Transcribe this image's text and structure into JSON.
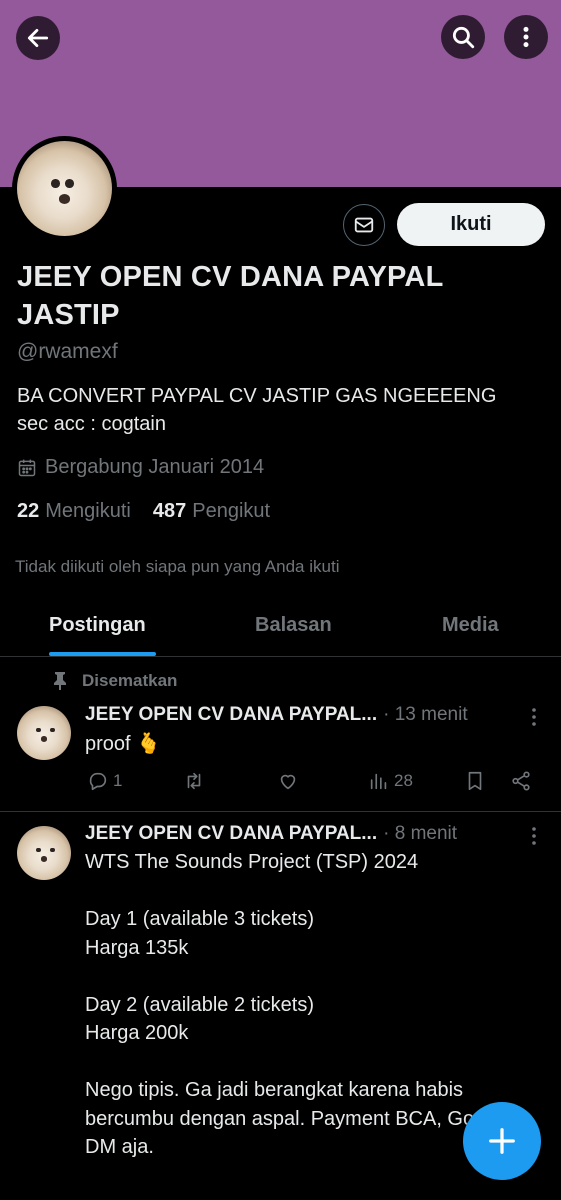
{
  "colors": {
    "banner": "#93599a",
    "accent": "#1d9bf0",
    "background": "#000000",
    "muted_text": "#71767b"
  },
  "header": {
    "back_icon": "arrow-left-icon",
    "search_icon": "search-icon",
    "more_icon": "more-vertical-icon"
  },
  "profile": {
    "name": "JEEY OPEN CV DANA PAYPAL JASTIP",
    "handle": "@rwamexf",
    "bio_line1": "BA CONVERT PAYPAL CV JASTIP GAS NGEEEENG",
    "bio_line2": "sec acc : cogtain",
    "joined": "Bergabung Januari 2014",
    "following_count": "22",
    "following_label": "Mengikuti",
    "followers_count": "487",
    "followers_label": "Pengikut",
    "not_followed_text": "Tidak diikuti oleh siapa pun yang Anda ikuti",
    "follow_button": "Ikuti"
  },
  "tabs": [
    {
      "label": "Postingan",
      "active": true
    },
    {
      "label": "Balasan",
      "active": false
    },
    {
      "label": "Media",
      "active": false
    }
  ],
  "posts": [
    {
      "pinned_label": "Disematkan",
      "name": "JEEY OPEN CV DANA PAYPAL...",
      "time": "· 13 menit",
      "text": "proof 🫰",
      "replies": "1",
      "retweets": "",
      "likes": "",
      "views": "28"
    },
    {
      "name": "JEEY OPEN CV DANA PAYPAL...",
      "time": "· 8 menit",
      "text": "WTS The Sounds Project (TSP) 2024\n\nDay 1 (available 3 tickets)\nHarga 135k\n\nDay 2 (available 2 tickets)\nHarga 200k\n\nNego tipis. Ga jadi berangkat karena habis bercumbu dengan aspal. Payment BCA, Gopay, DM aja."
    }
  ],
  "fab": {
    "icon": "plus-icon"
  }
}
